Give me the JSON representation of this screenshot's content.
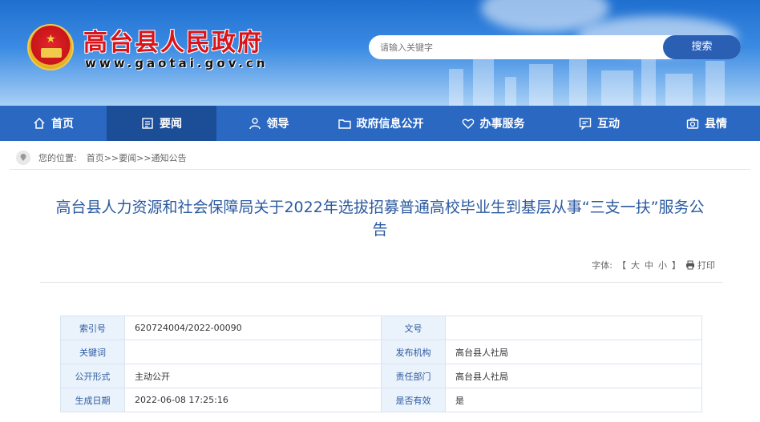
{
  "header": {
    "site_name": "高台县人民政府",
    "site_url": "www.gaotai.gov.cn",
    "search": {
      "placeholder": "请输入关键字",
      "button": "搜索"
    }
  },
  "nav": [
    {
      "label": "首页",
      "icon": "home-icon"
    },
    {
      "label": "要闻",
      "icon": "news-icon",
      "active": true
    },
    {
      "label": "领导",
      "icon": "user-icon"
    },
    {
      "label": "政府信息公开",
      "icon": "folder-icon"
    },
    {
      "label": "办事服务",
      "icon": "heart-icon"
    },
    {
      "label": "互动",
      "icon": "chat-icon"
    },
    {
      "label": "县情",
      "icon": "camera-icon"
    }
  ],
  "breadcrumb": {
    "label": "您的位置:",
    "path": "首页>>要闻>>通知公告"
  },
  "article": {
    "title": "高台县人力资源和社会保障局关于2022年选拔招募普通高校毕业生到基层从事“三支一扶”服务公告",
    "font_label": "字体:",
    "font_open": "【",
    "font_large": "大",
    "font_medium": "中",
    "font_small": "小",
    "font_close": "】",
    "print": "打印"
  },
  "meta": {
    "rows": [
      {
        "k1": "索引号",
        "v1": "620724004/2022-00090",
        "k2": "文号",
        "v2": ""
      },
      {
        "k1": "关键词",
        "v1": "",
        "k2": "发布机构",
        "v2": "高台县人社局"
      },
      {
        "k1": "公开形式",
        "v1": "主动公开",
        "k2": "责任部门",
        "v2": "高台县人社局"
      },
      {
        "k1": "生成日期",
        "v1": "2022-06-08 17:25:16",
        "k2": "是否有效",
        "v2": "是"
      }
    ]
  }
}
